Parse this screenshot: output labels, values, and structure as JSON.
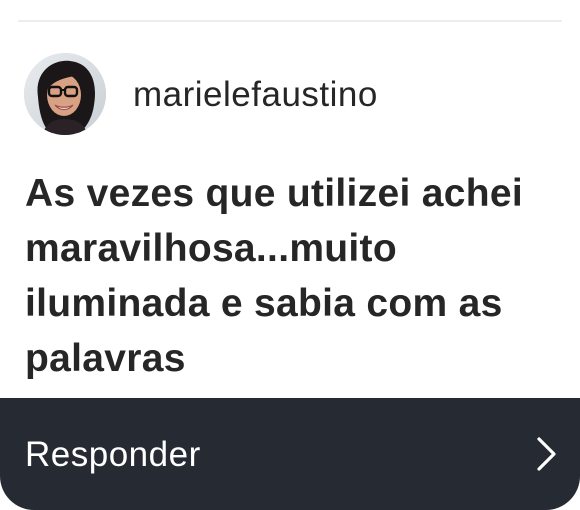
{
  "sender": {
    "username": "marielefaustino",
    "avatar": "profile-photo-avatar"
  },
  "message": {
    "text": "As vezes que utilizei achei maravilhosa...muito iluminada e sabia com as palavras"
  },
  "reply_bar": {
    "label": "Responder",
    "icon": "chevron-right-icon",
    "background": "#262a33"
  },
  "colors": {
    "text": "#262626",
    "card": "#ffffff"
  }
}
